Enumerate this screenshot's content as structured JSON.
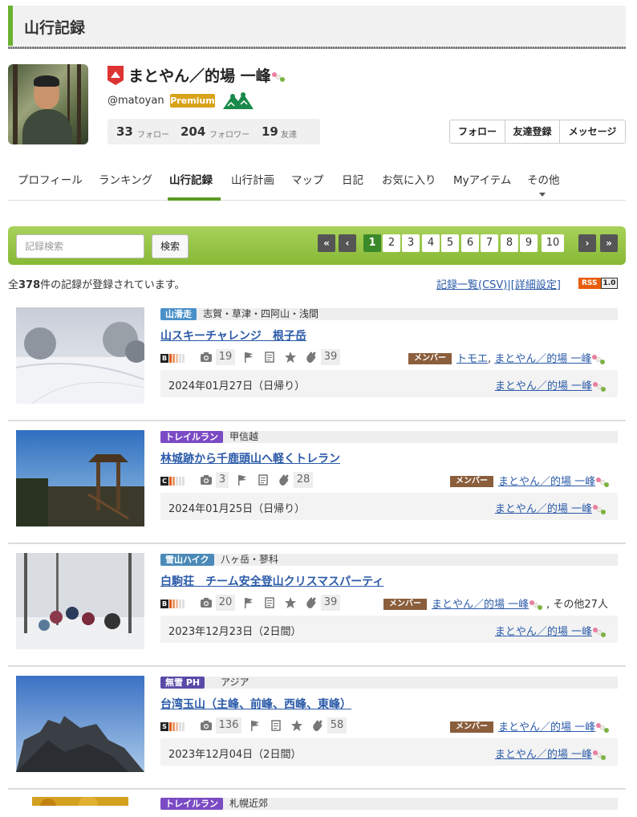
{
  "header": {
    "title": "山行記録"
  },
  "profile": {
    "name": "まとやん／的場 一峰",
    "handle": "@matoyan",
    "premium_label": "Premium",
    "stats": [
      {
        "value": "33",
        "label": "フォロー"
      },
      {
        "value": "204",
        "label": "フォロワー"
      },
      {
        "value": "19",
        "label": "友達"
      }
    ],
    "buttons": [
      "フォロー",
      "友達登録",
      "メッセージ"
    ]
  },
  "nav": {
    "tabs": [
      "プロフィール",
      "ランキング",
      "山行記録",
      "山行計画",
      "マップ",
      "日記",
      "お気に入り",
      "Myアイテム",
      "その他"
    ],
    "active": "山行記録"
  },
  "search": {
    "placeholder": "記録検索",
    "button": "検索",
    "pages": [
      "1",
      "2",
      "3",
      "4",
      "5",
      "6",
      "7",
      "8",
      "9",
      "10"
    ],
    "current_page": "1",
    "first": "«",
    "prev": "‹",
    "next": "›",
    "last": "»"
  },
  "summary": {
    "prefix": "全",
    "count": "378",
    "suffix": "件の記録が登録されています。",
    "links": "記録一覧(CSV)|[詳細設定]",
    "rss": "RSS",
    "rss_version": "1.0"
  },
  "colors": {
    "accent_green": "#6bb12f",
    "link": "#2a5aa8",
    "member": "#8b5e3c"
  },
  "records": [
    {
      "category": "山滑走",
      "cat_color": "#4a90c8",
      "area": "志賀・草津・四阿山・浅間",
      "title": "山スキーチャレンジ　根子岳",
      "grade": "B",
      "bars": 3,
      "photos": "19",
      "claps": "39",
      "member_label": "メンバー",
      "members": [
        "トモエ",
        "まとやん／的場 一峰"
      ],
      "members_extra": "",
      "date": "2024年01月27日（日帰り）",
      "author": "まとやん／的場 一峰"
    },
    {
      "category": "トレイルラン",
      "cat_color": "#7b4bc4",
      "area": "甲信越",
      "title": "林城跡から千鹿頭山へ軽くトレラン",
      "grade": "C",
      "bars": 2,
      "photos": "3",
      "claps": "28",
      "member_label": "メンバー",
      "members": [
        "まとやん／的場 一峰"
      ],
      "members_extra": "",
      "date": "2024年01月25日（日帰り）",
      "author": "まとやん／的場 一峰"
    },
    {
      "category": "雪山ハイク",
      "cat_color": "#4a8ab8",
      "area": "八ヶ岳・蓼科",
      "title": "白駒荘　チーム安全登山クリスマスパーティ",
      "grade": "B",
      "bars": 3,
      "photos": "20",
      "claps": "39",
      "member_label": "メンバー",
      "members": [
        "まとやん／的場 一峰"
      ],
      "members_extra": ", その他27人",
      "date": "2023年12月23日（2日間）",
      "author": "まとやん／的場 一峰"
    },
    {
      "category": "無雪 PH",
      "cat_color": "#5a4aa8",
      "area": "アジア",
      "title": "台湾玉山（主峰、前峰、西峰、東峰）",
      "grade": "S",
      "bars": 5,
      "photos": "136",
      "claps": "58",
      "member_label": "メンバー",
      "members": [
        "まとやん／的場 一峰"
      ],
      "members_extra": "",
      "date": "2023年12月04日（2日間）",
      "author": "まとやん／的場 一峰"
    },
    {
      "category": "トレイルラン",
      "cat_color": "#7b4bc4",
      "area": "札幌近郊"
    }
  ]
}
